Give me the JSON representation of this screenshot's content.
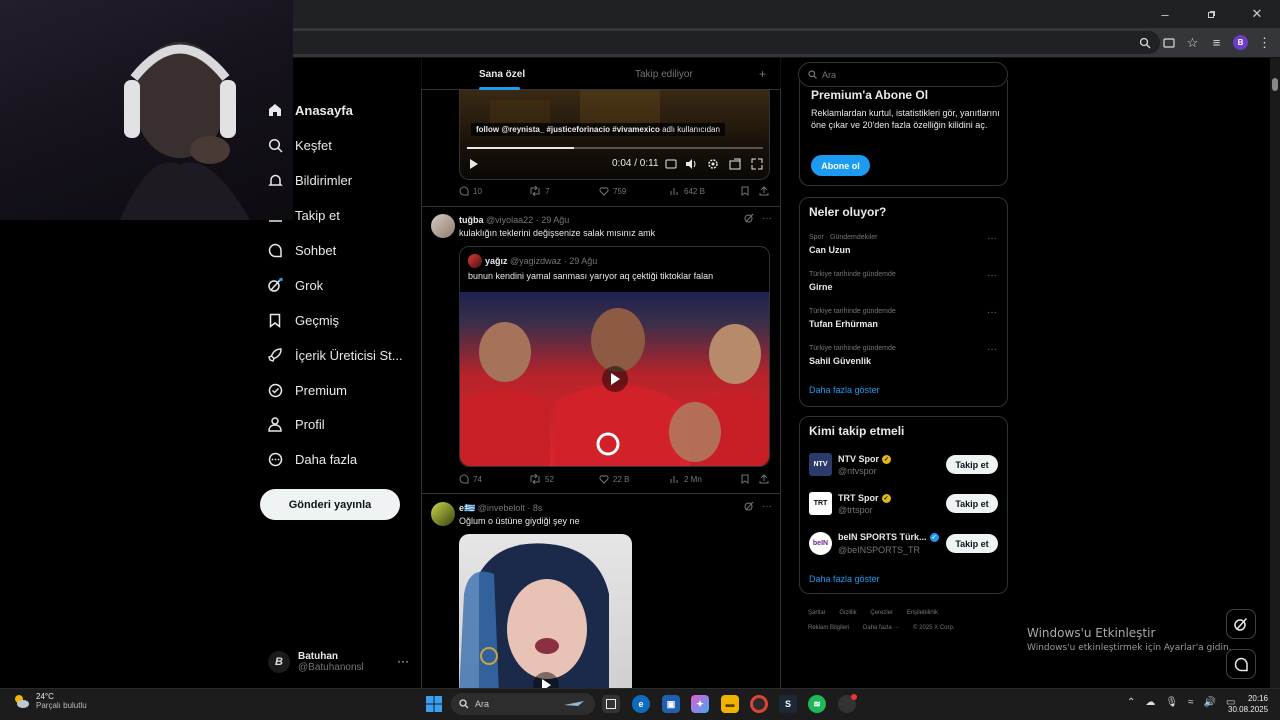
{
  "nav": {
    "items": [
      {
        "label": "Anasayfa",
        "icon": "home-icon"
      },
      {
        "label": "Keşfet",
        "icon": "search-icon"
      },
      {
        "label": "Bildirimler",
        "icon": "bell-icon"
      },
      {
        "label": "Takip et",
        "icon": "follow-icon"
      },
      {
        "label": "Sohbet",
        "icon": "chat-icon"
      },
      {
        "label": "Grok",
        "icon": "grok-icon"
      },
      {
        "label": "Geçmiş",
        "icon": "bookmark-icon"
      },
      {
        "label": "İçerik Üreticisi St...",
        "icon": "rocket-icon"
      },
      {
        "label": "Premium",
        "icon": "verified-icon"
      },
      {
        "label": "Profil",
        "icon": "person-icon"
      },
      {
        "label": "Daha fazla",
        "icon": "more-circle-icon"
      }
    ],
    "post_button": "Gönderi yayınla",
    "account": {
      "name": "Batuhan",
      "handle": "@Batuhanonsl",
      "avatar_letter": "B",
      "more": "···"
    }
  },
  "tabs": {
    "for_you": "Sana özel",
    "following": "Takip ediliyor",
    "plus": "+"
  },
  "post1": {
    "caption_bold": "follow @reynista_ #justiceforinacio #vivamexico",
    "caption_rest": " adlı kullanıcıdan",
    "time": "0:04 / 0:11",
    "progress": 0.36,
    "stats": {
      "replies": "10",
      "reposts": "7",
      "likes": "759",
      "views": "642 B"
    }
  },
  "post2": {
    "name": "tuğba",
    "handle": "@viyolaa22",
    "date": "· 29 Ağu",
    "text": "kulaklığın teklerini değişsenize salak mısınız amk",
    "quote": {
      "name": "yağız",
      "handle": "@yagizdwaz",
      "date": "· 29 Ağu",
      "text": "bunun kendini yamal sanması yarıyor aq çektiği tiktoklar falan"
    },
    "stats": {
      "replies": "74",
      "reposts": "52",
      "likes": "22 B",
      "views": "2 Mn"
    }
  },
  "post3": {
    "name": "e🇬🇷",
    "handle": "@invebelolt",
    "date": "· 8s",
    "text": "Oğlum o üstüne giydiği şey ne"
  },
  "right": {
    "search_placeholder": "Ara",
    "premium": {
      "title": "Premium'a Abone Ol",
      "desc": "Reklamlardan kurtul, istatistikleri gör, yanıtlarını öne çıkar ve 20'den fazla özelliğin kilidini aç.",
      "button": "Abone ol"
    },
    "trends": {
      "title": "Neler oluyor?",
      "items": [
        {
          "category": "Spor · Gündemdekiler",
          "name": "Can Uzun"
        },
        {
          "category": "Türkiye tarihinde gündemde",
          "name": "Girne"
        },
        {
          "category": "Türkiye tarihinde gündemde",
          "name": "Tufan Erhürman"
        },
        {
          "category": "Türkiye tarihinde gündemde",
          "name": "Sahil Güvenlik"
        }
      ],
      "show_more": "Daha fazla göster"
    },
    "who_to_follow": {
      "title": "Kimi takip etmeli",
      "items": [
        {
          "name": "NTV Spor",
          "handle": "@ntvspor",
          "avatar_text": "NTV",
          "badge_color": "#e2b719"
        },
        {
          "name": "TRT Spor",
          "handle": "@trtspor",
          "avatar_text": "TRT",
          "badge_color": "#e2b719"
        },
        {
          "name": "beIN SPORTS Türk...",
          "handle": "@beINSPORTS_TR",
          "avatar_text": "beIN",
          "badge_color": "#1d9bf0"
        }
      ],
      "follow_label": "Takip et",
      "show_more": "Daha fazla göster"
    },
    "footer": [
      "Şartlar",
      "Gizlilik",
      "Çerezler",
      "Erişilebilirlik",
      "Reklam Bilgileri",
      "Daha fazla ···",
      "© 2025 X Corp."
    ]
  },
  "windows": {
    "activate_title": "Windows'u Etkinleştir",
    "activate_sub": "Windows'u etkinleştirmek için Ayarlar'a gidin.",
    "weather_temp": "24°C",
    "weather_desc": "Parçalı bulutlu",
    "search_placeholder": "Ara",
    "time": "20:16",
    "date": "30.08.2025"
  },
  "colors": {
    "accent": "#1d9bf0",
    "background": "#000000",
    "border": "#2f3336",
    "muted": "#71767b"
  }
}
